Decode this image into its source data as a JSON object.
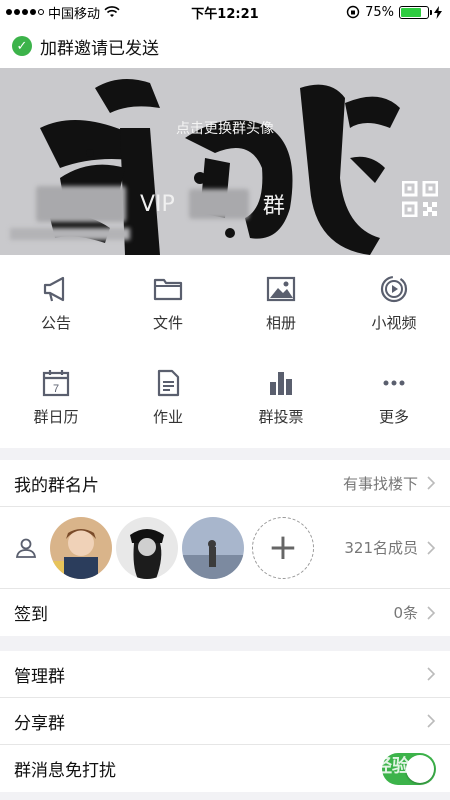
{
  "status_bar": {
    "carrier": "中国移动",
    "time": "下午12:21",
    "battery_percent": "75%",
    "battery_level": 0.75
  },
  "toast": {
    "message": "加群邀请已发送"
  },
  "hero": {
    "hint": "点击更换群头像",
    "group_name_visible": "VIP",
    "group_name_suffix": "群"
  },
  "features": [
    {
      "label": "公告",
      "icon": "megaphone-icon"
    },
    {
      "label": "文件",
      "icon": "folder-icon"
    },
    {
      "label": "相册",
      "icon": "photo-album-icon"
    },
    {
      "label": "小视频",
      "icon": "video-icon"
    },
    {
      "label": "群日历",
      "icon": "calendar-icon"
    },
    {
      "label": "作业",
      "icon": "document-icon"
    },
    {
      "label": "群投票",
      "icon": "bar-chart-icon"
    },
    {
      "label": "更多",
      "icon": "more-icon"
    }
  ],
  "calendar_day": "7",
  "group_card": {
    "label": "我的群名片",
    "value": "有事找楼下"
  },
  "members": {
    "count_label": "321名成员"
  },
  "checkin": {
    "label": "签到",
    "value": "0条"
  },
  "settings": {
    "manage": "管理群",
    "share": "分享群",
    "mute": "群消息免打扰",
    "mute_on": true
  },
  "colors": {
    "accent_green": "#3cb34a",
    "icon_gray": "#5a5f6e"
  },
  "watermark": "Baidu 经验"
}
